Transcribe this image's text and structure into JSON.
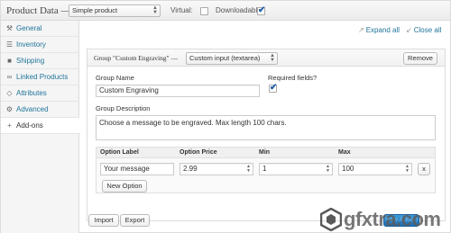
{
  "header": {
    "title": "Product Data —",
    "product_type": "Simple product",
    "virtual_label": "Virtual:",
    "virtual_checked": false,
    "downloadable_label": "Downloadable:",
    "downloadable_checked": true
  },
  "sidebar": {
    "items": [
      {
        "label": "General",
        "icon": "wrench-icon",
        "glyph": "⚒"
      },
      {
        "label": "Inventory",
        "icon": "inventory-icon",
        "glyph": "☰"
      },
      {
        "label": "Shipping",
        "icon": "truck-icon",
        "glyph": "■"
      },
      {
        "label": "Linked Products",
        "icon": "link-icon",
        "glyph": "∞"
      },
      {
        "label": "Attributes",
        "icon": "tag-icon",
        "glyph": "◇"
      },
      {
        "label": "Advanced",
        "icon": "gear-icon",
        "glyph": "⚙"
      },
      {
        "label": "Add-ons",
        "icon": "plus-icon",
        "glyph": "+"
      }
    ],
    "active_index": 6
  },
  "toolbar": {
    "expand_all": "Expand all",
    "close_all": "Close all"
  },
  "group": {
    "title": "Group \"Custom Engraving\" —",
    "type": "Custom input (textarea)",
    "remove_label": "Remove",
    "name_label": "Group Name",
    "name_value": "Custom Engraving",
    "required_label": "Required fields?",
    "required_checked": true,
    "description_label": "Group Description",
    "description_value": "Choose a message to be engraved. Max length 100 chars.",
    "options": {
      "headers": [
        "Option Label",
        "Option Price",
        "Min",
        "Max"
      ],
      "rows": [
        {
          "label": "Your message",
          "price": "2.99",
          "min": "1",
          "max": "100",
          "remove": "x"
        }
      ],
      "new_option_label": "New Option"
    }
  },
  "footer": {
    "import_label": "Import",
    "export_label": "Export",
    "add_group_label": "New Addon Group"
  },
  "watermark": {
    "text": "gfxtra.com"
  },
  "colors": {
    "link": "#21759b",
    "primary_button": "#1f6fb5",
    "checkbox_tick": "#1e5ea8"
  }
}
